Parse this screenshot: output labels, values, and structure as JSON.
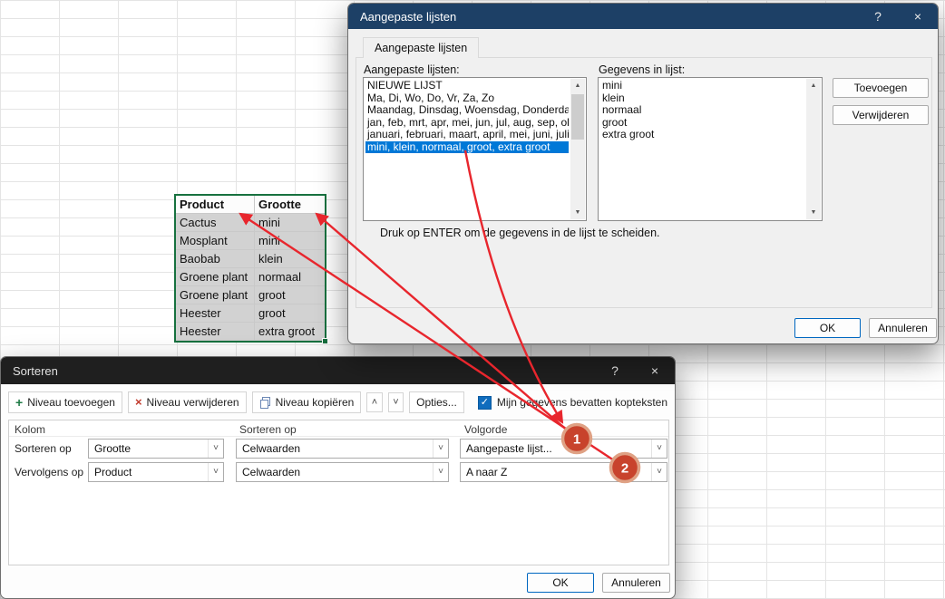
{
  "colors": {
    "selection_green": "#17713f",
    "selection_blue": "#0078d7",
    "annotation_red": "#e8262d",
    "badge_fill": "#c8432c",
    "sort_titlebar": "#1f1f1f",
    "lists_titlebar": "#1d4066"
  },
  "icons": {
    "help": "?",
    "close": "×",
    "add_level": "+",
    "remove_level": "×",
    "move_up": "˄",
    "move_down": "˅",
    "dropdown": "˅",
    "scroll_up": "▲",
    "scroll_down": "▼",
    "checkmark": "✓"
  },
  "table": {
    "headers": [
      "Product",
      "Grootte"
    ],
    "rows": [
      [
        "Cactus",
        "mini"
      ],
      [
        "Mosplant",
        "mini"
      ],
      [
        "Baobab",
        "klein"
      ],
      [
        "Groene plant",
        "normaal"
      ],
      [
        "Groene plant",
        "groot"
      ],
      [
        "Heester",
        "groot"
      ],
      [
        "Heester",
        "extra groot"
      ]
    ]
  },
  "custom_lists_dialog": {
    "title": "Aangepaste lijsten",
    "tab": "Aangepaste lijsten",
    "lists_label": "Aangepaste lijsten:",
    "entries_label": "Gegevens in lijst:",
    "lists": [
      "NIEUWE LIJST",
      "Ma, Di, Wo, Do, Vr, Za, Zo",
      "Maandag, Dinsdag, Woensdag, Donderdag,",
      "jan, feb, mrt, apr, mei, jun, jul, aug, sep, okt,",
      "januari, februari, maart, april, mei, juni, juli, a",
      "mini, klein, normaal, groot, extra groot"
    ],
    "selected_list_index": 5,
    "entries": [
      "mini",
      "klein",
      "normaal",
      "groot",
      "extra groot"
    ],
    "add_button": "Toevoegen",
    "delete_button": "Verwijderen",
    "hint": "Druk op ENTER om de gegevens in de lijst te scheiden.",
    "ok": "OK",
    "cancel": "Annuleren"
  },
  "sort_dialog": {
    "title": "Sorteren",
    "toolbar": {
      "add_level": "Niveau toevoegen",
      "delete_level": "Niveau verwijderen",
      "copy_level": "Niveau kopiëren",
      "options": "Opties...",
      "header_checkbox": "Mijn gegevens bevatten kopteksten",
      "header_checked": true
    },
    "columns": [
      "Kolom",
      "Sorteren op",
      "Volgorde"
    ],
    "levels": [
      {
        "label": "Sorteren op",
        "column": "Grootte",
        "sort_on": "Celwaarden",
        "order": "Aangepaste lijst..."
      },
      {
        "label": "Vervolgens op",
        "column": "Product",
        "sort_on": "Celwaarden",
        "order": "A naar Z"
      }
    ],
    "ok": "OK",
    "cancel": "Annuleren"
  },
  "annotations": {
    "badge1": "1",
    "badge2": "2"
  }
}
